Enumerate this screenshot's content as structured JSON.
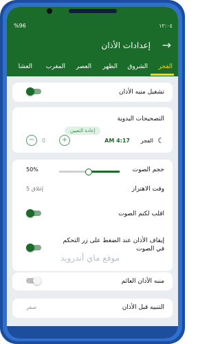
{
  "status": {
    "time": "١٢:٠٤",
    "left": "%96"
  },
  "header": {
    "title": "إعدادات الأذان",
    "back": "→"
  },
  "tabs": [
    {
      "label": "الفجر"
    },
    {
      "label": "الشروق"
    },
    {
      "label": "الظهر"
    },
    {
      "label": "العصر"
    },
    {
      "label": "المغرب"
    },
    {
      "label": "العشا"
    }
  ],
  "settings": {
    "enable_alarm": "تشغيل منبه الأذان",
    "manual_corrections": "التصحيحات اليدوية",
    "reset": "إعادة التعيين",
    "fajr_label": "الفجر",
    "fajr_time": "AM 4:17",
    "manual_value": "0",
    "volume": "حجم الصوت",
    "volume_value": "50%",
    "vibration": "وقت الاهتزاز",
    "vibration_value": "5 إغلاق",
    "flip_to_mute": "اقلب لكتم الصوت",
    "stop_on_volume": "إيقاف الأذان عند الضغط على زر التحكم في الصوت",
    "floating_alarm": "منبه الأذان العائم",
    "before_alert": "التنبيه قبل الأذان",
    "before_alert_value": "صفر"
  },
  "watermark": "موقع ماي أندرويد"
}
